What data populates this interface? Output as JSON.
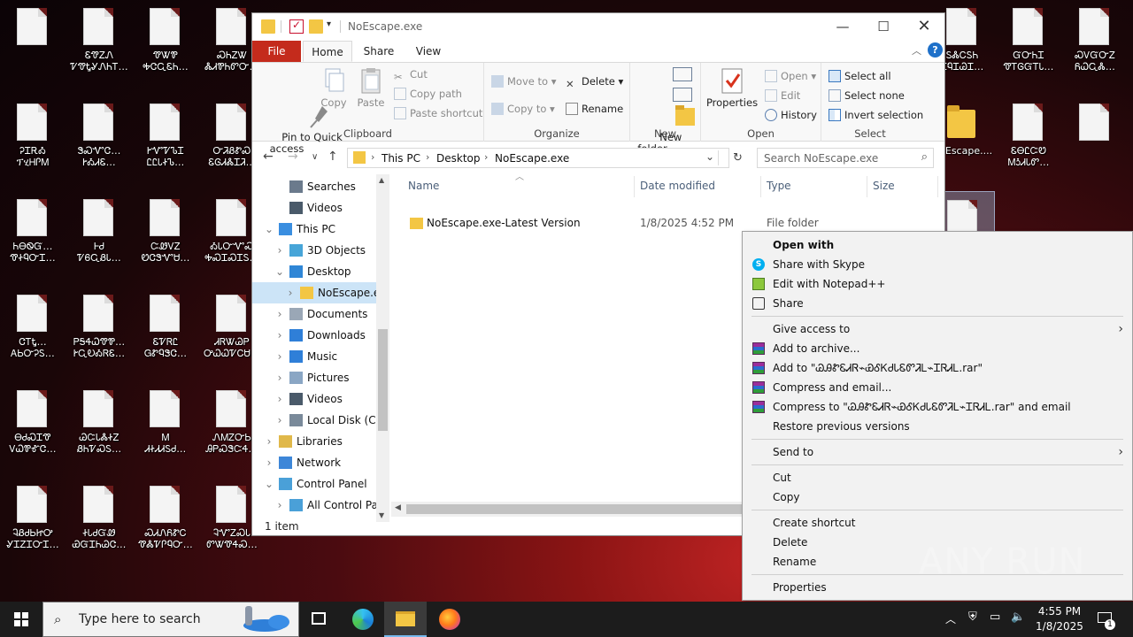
{
  "desktop": {
    "icons": [
      {
        "label": "",
        "type": "doc"
      },
      {
        "label": "ᎮᏆᎡᎣ\nፕሂᎻᎵᎷ",
        "type": "doc"
      },
      {
        "label": "ᏂᎾᏫᏳ…\nᏡᏐᏄᏅᏆ…",
        "type": "doc"
      },
      {
        "label": "ᏣᎢᎿ…\nᎪᏏᏅᎮᏚ…",
        "type": "doc"
      },
      {
        "label": "ᎾᏧᏍᏆᏡ\nᏙᏇᏈᎹᏣ…",
        "type": "doc"
      },
      {
        "label": "ᎸᏰᏧᏏᏥᎤ\nᎽᏆᏃᏆᏅᏆ…",
        "type": "doc"
      },
      {
        "label": "ᏋᏡᏃᏁ\nᏤᏡᎿᎽᏁᏂᎢ…",
        "type": "doc"
      },
      {
        "label": "ᏕᏍᏉᏣ…\nᎨᎣᏗᏋ…",
        "type": "doc"
      },
      {
        "label": "ᎰᏧ\nᏤᏮᏩᏰᏓ…",
        "type": "doc"
      },
      {
        "label": "ᏢᎦᏎᏇᏡᏈ…\nᎨᏩᎧᎣᏒᏋ…",
        "type": "doc"
      },
      {
        "label": "ᏊᏨᏓᏜᏐᏃ\nᏰᏂᏤᏍᏚ…",
        "type": "doc"
      },
      {
        "label": "ᏐᏓᏧᏳᏪ\nᏯᏳᏆᏂᏊᏣ…",
        "type": "doc"
      },
      {
        "label": "ᏡᏔᏈ\nᎭᏣᏩᏋᏂ…",
        "type": "doc"
      },
      {
        "label": "ᎨᏉᏤᏖᏆ\nᏝᏝᏓᏐᏖ…",
        "type": "doc"
      },
      {
        "label": "ᏨᏪᏙᏃ\nᏬᏣᏕᏉᏌ…",
        "type": "doc"
      },
      {
        "label": "ᏋᏤᏒᏝ\nᏀᏑᏄᏕᏣ…",
        "type": "doc"
      },
      {
        "label": "Ꮇ\nᏗᏐᏗᏗᏚᏧ…",
        "type": "doc"
      },
      {
        "label": "ᏍᏗᏁᏲᏑᏟ\nᏡᏜᏤᎵᏄᏅ…",
        "type": "doc"
      },
      {
        "label": "ᏍᏂᏃᏔ\nᏜᏗᏈᏂᏛᏅ…",
        "type": "doc"
      },
      {
        "label": "ᏅᏘᏰᏑᏍ\nᏋᎶᏗᏜᏆᏘ…",
        "type": "doc"
      },
      {
        "label": "ᎣᏓᏅᏉᏍ\nᎭᏍᏆᏍᏆᏚ…",
        "type": "doc"
      },
      {
        "label": "ᏗᏒᏔᏊᏢ\nᎤᏇᏇᏤᏟᏌ…",
        "type": "doc"
      },
      {
        "label": "ᏁᎷᏃᏅᏏ\nᎯᏢᏍᏕᏨᏎ…",
        "type": "doc"
      },
      {
        "label": "ᎸᏉᏃᏍᏓ\nᏛᏔᏡᏎᏍ…",
        "type": "doc"
      },
      {
        "label": "ᏚᏜᏟᏚᏂ\nᏆᏄᏆᏊᏆ…",
        "type": "doc"
      },
      {
        "label": "ᏳᏅᏂᏆ\nᏡᎢᎶᏳᎢᏓ…",
        "type": "doc"
      },
      {
        "label": "ᏍᏙᏳᏅᏃ\nᏲᏇᏩᏜ…",
        "type": "doc"
      },
      {
        "label": "NoEscape....",
        "type": "folder"
      },
      {
        "label": "ᏋᎾᏝᏨᏬ\nᎷᎼᏗᏓᏛ…",
        "type": "doc"
      },
      {
        "label": "",
        "type": "doc"
      },
      {
        "label": "",
        "type": "doc"
      }
    ]
  },
  "explorer": {
    "title": "NoEscape.exe",
    "tabs": [
      "File",
      "Home",
      "Share",
      "View"
    ],
    "ribbon": {
      "clipboard": {
        "group": "Clipboard",
        "pin": "Pin to Quick\naccess",
        "copy": "Copy",
        "paste": "Paste",
        "cut": "Cut",
        "copy_path": "Copy path",
        "paste_shortcut": "Paste shortcut"
      },
      "organize": {
        "group": "Organize",
        "move_to": "Move to",
        "copy_to": "Copy to",
        "delete": "Delete",
        "rename": "Rename"
      },
      "new": {
        "group": "New",
        "new_folder": "New\nfolder"
      },
      "open": {
        "group": "Open",
        "properties": "Properties",
        "open": "Open",
        "edit": "Edit",
        "history": "History"
      },
      "select": {
        "group": "Select",
        "select_all": "Select all",
        "select_none": "Select none",
        "invert": "Invert selection"
      }
    },
    "address": {
      "crumbs": [
        "This PC",
        "Desktop",
        "NoEscape.exe"
      ],
      "search_placeholder": "Search NoEscape.exe"
    },
    "nav": [
      {
        "label": "Searches",
        "indent": 1,
        "icon": "search-icon",
        "expander": ""
      },
      {
        "label": "Videos",
        "indent": 1,
        "icon": "video-icon",
        "expander": ""
      },
      {
        "label": "This PC",
        "indent": 0,
        "icon": "pc-icon",
        "expander": "v"
      },
      {
        "label": "3D Objects",
        "indent": 1,
        "icon": "cube-icon",
        "expander": ">"
      },
      {
        "label": "Desktop",
        "indent": 1,
        "icon": "desktop-icon",
        "expander": "v"
      },
      {
        "label": "NoEscape.exe",
        "indent": 2,
        "icon": "folder-icon",
        "expander": ">",
        "selected": true
      },
      {
        "label": "Documents",
        "indent": 1,
        "icon": "documents-icon",
        "expander": ">"
      },
      {
        "label": "Downloads",
        "indent": 1,
        "icon": "download-icon",
        "expander": ">"
      },
      {
        "label": "Music",
        "indent": 1,
        "icon": "music-icon",
        "expander": ">"
      },
      {
        "label": "Pictures",
        "indent": 1,
        "icon": "pictures-icon",
        "expander": ">"
      },
      {
        "label": "Videos",
        "indent": 1,
        "icon": "video-icon",
        "expander": ">"
      },
      {
        "label": "Local Disk (C:)",
        "indent": 1,
        "icon": "disk-icon",
        "expander": ">"
      },
      {
        "label": "Libraries",
        "indent": 0,
        "icon": "libraries-icon",
        "expander": ">"
      },
      {
        "label": "Network",
        "indent": 0,
        "icon": "network-icon",
        "expander": ">"
      },
      {
        "label": "Control Panel",
        "indent": 0,
        "icon": "control-panel-icon",
        "expander": "v"
      },
      {
        "label": "All Control Par",
        "indent": 1,
        "icon": "control-panel-icon",
        "expander": ">"
      }
    ],
    "columns": [
      "Name",
      "Date modified",
      "Type",
      "Size"
    ],
    "files": [
      {
        "name": "NoEscape.exe-Latest Version",
        "date": "1/8/2025 4:52 PM",
        "type": "File folder",
        "size": ""
      }
    ],
    "status": "1 item"
  },
  "context_menu": {
    "items": [
      {
        "label": "Open with",
        "bold": true,
        "icon": ""
      },
      {
        "label": "Share with Skype",
        "icon": "skype-icon"
      },
      {
        "label": "Edit with Notepad++",
        "icon": "notepad-plus-icon"
      },
      {
        "label": "Share",
        "icon": "share-icon"
      },
      {
        "sep": true
      },
      {
        "label": "Give access to",
        "arrow": true
      },
      {
        "label": "Add to archive...",
        "icon": "winrar-icon"
      },
      {
        "label": "Add to \"ᏊᎯᏑᏋᏗᏒ⌁ᏯᎴᏦᏧᏓᏋᏛᏘᏞ⌁ᏆᏒᏗᏞ.rar\"",
        "icon": "winrar-icon"
      },
      {
        "label": "Compress and email...",
        "icon": "winrar-icon"
      },
      {
        "label": "Compress to \"ᏊᎯᏑᏋᏗᏒ⌁ᏯᎴᏦᏧᏓᏋᏛᏘᏞ⌁ᏆᏒᏗᏞ.rar\" and email",
        "icon": "winrar-icon"
      },
      {
        "label": "Restore previous versions",
        "icon": ""
      },
      {
        "sep": true
      },
      {
        "label": "Send to",
        "arrow": true
      },
      {
        "sep": true
      },
      {
        "label": "Cut"
      },
      {
        "label": "Copy"
      },
      {
        "sep": true
      },
      {
        "label": "Create shortcut"
      },
      {
        "label": "Delete"
      },
      {
        "label": "Rename"
      },
      {
        "sep": true
      },
      {
        "label": "Properties"
      }
    ]
  },
  "watermark": "ANY RUN",
  "taskbar": {
    "search_placeholder": "Type here to search",
    "time": "4:55 PM",
    "date": "1/8/2025",
    "notification_count": "1"
  }
}
